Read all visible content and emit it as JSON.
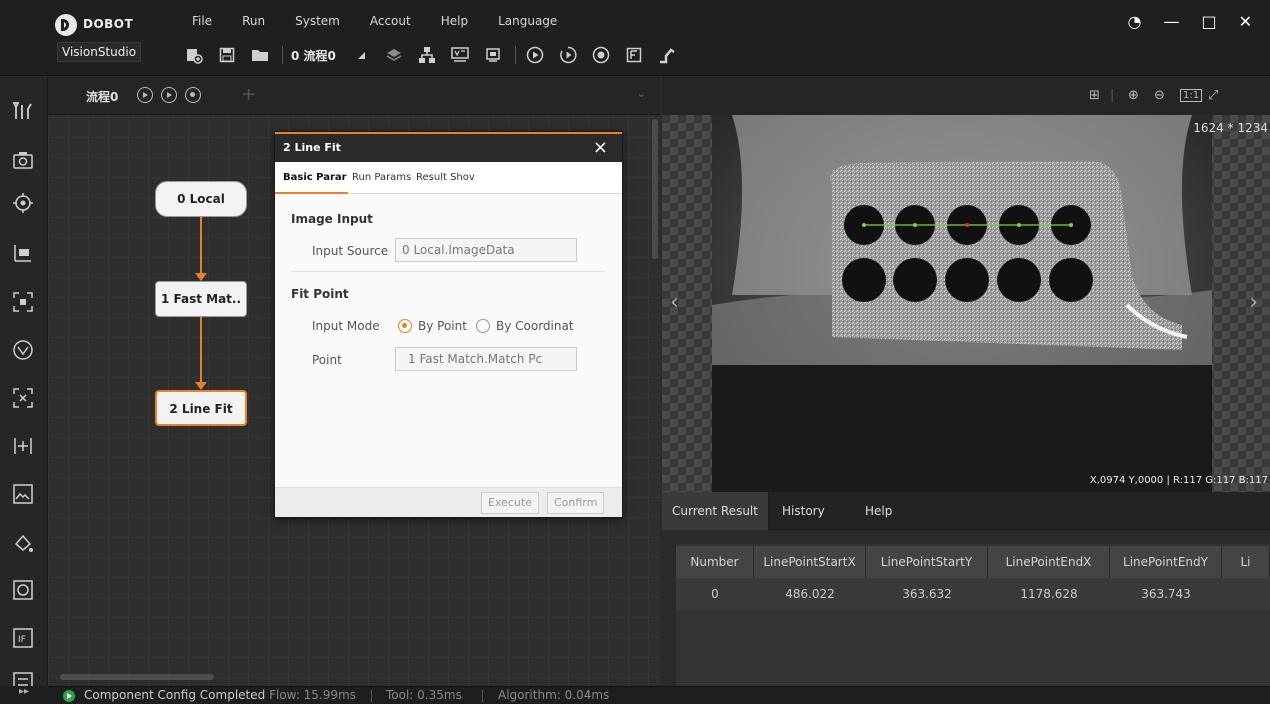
{
  "app": {
    "brand": "DOBOT",
    "product": "VisionStudio"
  },
  "menu": [
    "File",
    "Run",
    "System",
    "Accout",
    "Help",
    "Language"
  ],
  "toolbar": {
    "flow_name": "0 流程0"
  },
  "flow": {
    "tab_label": "流程0",
    "nodes": [
      {
        "label": "0 Local"
      },
      {
        "label": "1 Fast Mat.."
      },
      {
        "label": "2 Line Fit"
      }
    ]
  },
  "dialog": {
    "title": "2 Line Fit",
    "tabs": [
      "Basic Parar",
      "Run Params",
      "Result Shov"
    ],
    "image_input_section": "Image Input",
    "input_source_label": "Input Source",
    "input_source_value": "0 Local.ImageData",
    "fit_point_section": "Fit Point",
    "input_mode_label": "Input Mode",
    "mode_options": [
      "By Point",
      "By Coordinat"
    ],
    "mode_selected": "By Point",
    "point_label": "Point",
    "point_value": "1 Fast Match.Match Pc",
    "execute_label": "Execute",
    "confirm_label": "Confirm"
  },
  "image_view": {
    "size_text": "1624 * 1234",
    "coords_text": "X,0974  Y,0000  |  R:117  G:117  B:117"
  },
  "results": {
    "tabs": [
      "Current Result",
      "History",
      "Help"
    ],
    "active_tab": "Current Result",
    "columns": [
      "Number",
      "LinePointStartX",
      "LinePointStartY",
      "LinePointEndX",
      "LinePointEndY",
      "Li"
    ],
    "rows": [
      [
        "0",
        "486.022",
        "363.632",
        "1178.628",
        "363.743",
        ""
      ]
    ]
  },
  "status": {
    "message": "Component Config Completed",
    "flow_time": "Flow: 15.99ms",
    "tool_time": "Tool: 0.35ms",
    "algorithm_time": "Algorithm: 0.04ms"
  },
  "colors": {
    "accent": "#e6822a",
    "fit_line": "#7cd63a",
    "run_status": "#2aa44a"
  }
}
